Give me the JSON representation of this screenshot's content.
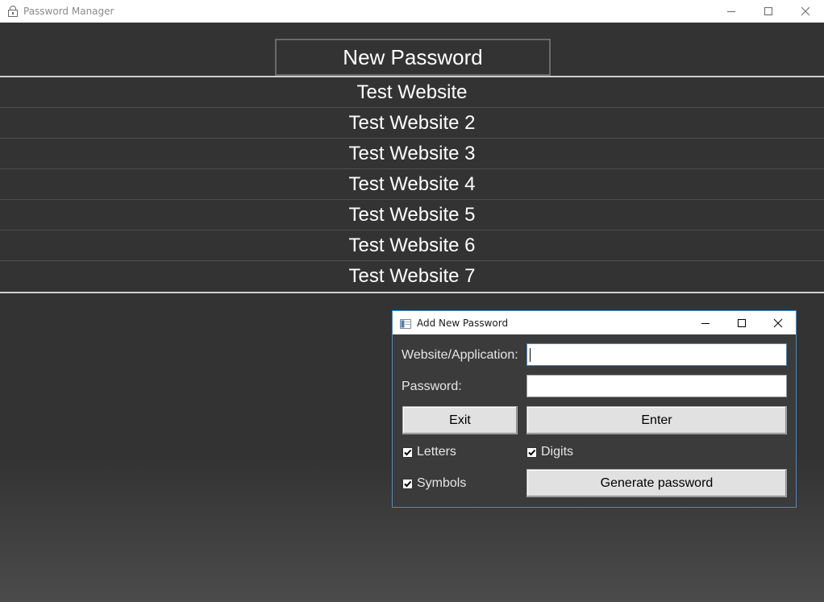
{
  "window": {
    "title": "Password Manager",
    "icon": "lock-icon",
    "controls": [
      "minimize-icon",
      "maximize-icon",
      "close-icon"
    ]
  },
  "main": {
    "new_password_label": "New Password",
    "sites": [
      "Test Website",
      "Test Website 2",
      "Test Website 3",
      "Test Website 4",
      "Test Website 5",
      "Test Website 6",
      "Test Website 7"
    ]
  },
  "dialog": {
    "title": "Add New Password",
    "website_label": "Website/Application:",
    "website_value": "",
    "password_label": "Password:",
    "password_value": "",
    "exit_label": "Exit",
    "enter_label": "Enter",
    "letters_label": "Letters",
    "letters_checked": true,
    "digits_label": "Digits",
    "digits_checked": true,
    "symbols_label": "Symbols",
    "symbols_checked": true,
    "generate_label": "Generate password"
  },
  "colors": {
    "background": "#333333",
    "focus_accent": "#3c8fd6",
    "text": "#ffffff"
  }
}
